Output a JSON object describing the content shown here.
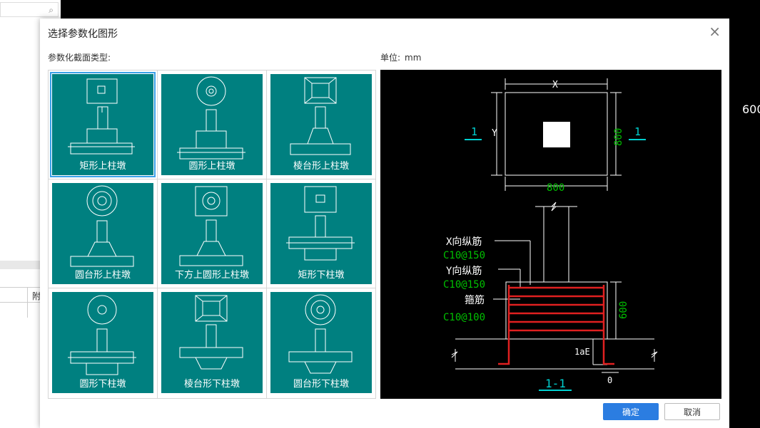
{
  "background": {
    "side_value": "600",
    "grid_header": "附"
  },
  "dialog": {
    "title": "选择参数化图形",
    "type_label": "参数化截面类型:",
    "unit_label": "单位:",
    "unit_value": "mm",
    "ok_label": "确定",
    "cancel_label": "取消",
    "close_glyph": "×"
  },
  "gallery": {
    "items": [
      {
        "label": "矩形上柱墩",
        "selected": true
      },
      {
        "label": "圆形上柱墩"
      },
      {
        "label": "棱台形上柱墩"
      },
      {
        "label": "圆台形上柱墩"
      },
      {
        "label": "下方上圆形上柱墩"
      },
      {
        "label": "矩形下柱墩"
      },
      {
        "label": "圆形下柱墩"
      },
      {
        "label": "棱台形下柱墩"
      },
      {
        "label": "圆台形下柱墩"
      }
    ]
  },
  "preview": {
    "x_label": "X",
    "y_label": "Y",
    "bottom_dim": "800",
    "right_dim": "800",
    "section_mark_left": "1",
    "section_mark_right": "1",
    "x_rebar_label": "X向纵筋",
    "x_rebar_spec": "C10@150",
    "y_rebar_label": "Y向纵筋",
    "y_rebar_spec": "C10@150",
    "stirrup_label": "箍筋",
    "stirrup_spec": "C10@100",
    "height_dim": "600",
    "anchor_label": "1aE",
    "bottom_offset": "0",
    "section_title": "1-1"
  },
  "colors": {
    "teal": "#008080",
    "accent": "#2b7de1",
    "green_dim": "#00c000",
    "rebar_red": "#e02020",
    "cyan_mark": "#00d0d0"
  }
}
